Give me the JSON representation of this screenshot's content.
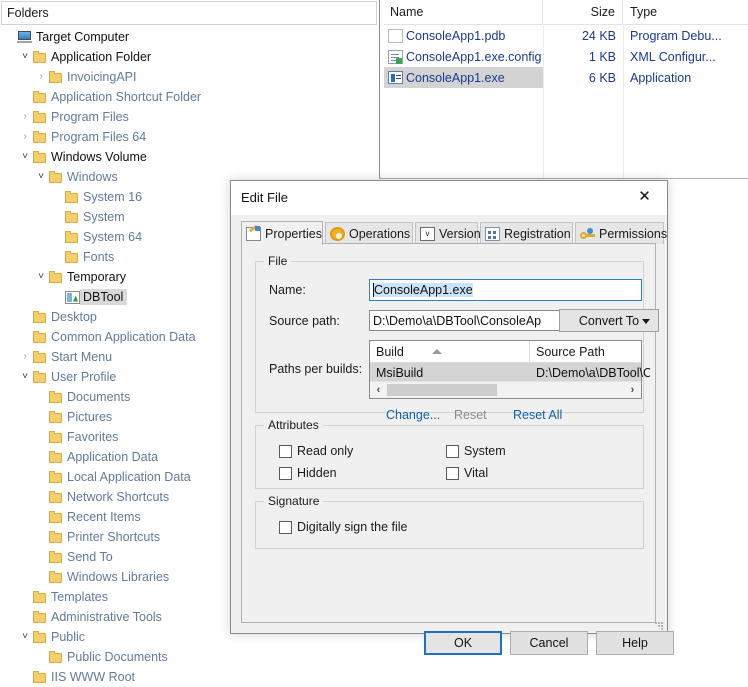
{
  "tree": {
    "header": "Folders",
    "nodes": [
      {
        "label": "Target Computer",
        "indent": 0,
        "chev": "none",
        "icon": "computer-icon",
        "style": "dark"
      },
      {
        "label": "Application Folder",
        "indent": 1,
        "chev": "expanded",
        "icon": "folder-icon",
        "style": "dark"
      },
      {
        "label": "InvoicingAPI",
        "indent": 2,
        "chev": "collapsed",
        "icon": "folder-icon",
        "style": "blue"
      },
      {
        "label": "Application Shortcut Folder",
        "indent": 1,
        "chev": "none",
        "icon": "folder-icon",
        "style": "blue"
      },
      {
        "label": "Program Files",
        "indent": 1,
        "chev": "collapsed",
        "icon": "folder-icon",
        "style": "blue"
      },
      {
        "label": "Program Files 64",
        "indent": 1,
        "chev": "collapsed",
        "icon": "folder-icon",
        "style": "blue"
      },
      {
        "label": "Windows Volume",
        "indent": 1,
        "chev": "expanded",
        "icon": "folder-icon",
        "style": "dark"
      },
      {
        "label": "Windows",
        "indent": 2,
        "chev": "expanded",
        "icon": "folder-icon",
        "style": "blue"
      },
      {
        "label": "System 16",
        "indent": 3,
        "chev": "none",
        "icon": "folder-icon",
        "style": "blue"
      },
      {
        "label": "System",
        "indent": 3,
        "chev": "none",
        "icon": "folder-icon",
        "style": "blue"
      },
      {
        "label": "System 64",
        "indent": 3,
        "chev": "none",
        "icon": "folder-icon",
        "style": "blue"
      },
      {
        "label": "Fonts",
        "indent": 3,
        "chev": "none",
        "icon": "folder-icon",
        "style": "blue"
      },
      {
        "label": "Temporary",
        "indent": 2,
        "chev": "expanded",
        "icon": "folder-icon",
        "style": "dark"
      },
      {
        "label": "DBTool",
        "indent": 3,
        "chev": "none",
        "icon": "application-icon",
        "style": "selected"
      },
      {
        "label": "Desktop",
        "indent": 1,
        "chev": "none",
        "icon": "folder-icon",
        "style": "blue"
      },
      {
        "label": "Common Application Data",
        "indent": 1,
        "chev": "none",
        "icon": "folder-icon",
        "style": "blue"
      },
      {
        "label": "Start Menu",
        "indent": 1,
        "chev": "collapsed",
        "icon": "folder-icon",
        "style": "blue"
      },
      {
        "label": "User Profile",
        "indent": 1,
        "chev": "expanded",
        "icon": "folder-icon",
        "style": "blue"
      },
      {
        "label": "Documents",
        "indent": 2,
        "chev": "none",
        "icon": "folder-icon",
        "style": "blue"
      },
      {
        "label": "Pictures",
        "indent": 2,
        "chev": "none",
        "icon": "folder-icon",
        "style": "blue"
      },
      {
        "label": "Favorites",
        "indent": 2,
        "chev": "none",
        "icon": "folder-icon",
        "style": "blue"
      },
      {
        "label": "Application Data",
        "indent": 2,
        "chev": "none",
        "icon": "folder-icon",
        "style": "blue"
      },
      {
        "label": "Local Application Data",
        "indent": 2,
        "chev": "none",
        "icon": "folder-icon",
        "style": "blue"
      },
      {
        "label": "Network Shortcuts",
        "indent": 2,
        "chev": "none",
        "icon": "folder-icon",
        "style": "blue"
      },
      {
        "label": "Recent Items",
        "indent": 2,
        "chev": "none",
        "icon": "folder-icon",
        "style": "blue"
      },
      {
        "label": "Printer Shortcuts",
        "indent": 2,
        "chev": "none",
        "icon": "folder-icon",
        "style": "blue"
      },
      {
        "label": "Send To",
        "indent": 2,
        "chev": "none",
        "icon": "folder-icon",
        "style": "blue"
      },
      {
        "label": "Windows Libraries",
        "indent": 2,
        "chev": "none",
        "icon": "folder-icon",
        "style": "blue"
      },
      {
        "label": "Templates",
        "indent": 1,
        "chev": "none",
        "icon": "folder-icon",
        "style": "blue"
      },
      {
        "label": "Administrative Tools",
        "indent": 1,
        "chev": "none",
        "icon": "folder-icon",
        "style": "blue"
      },
      {
        "label": "Public",
        "indent": 1,
        "chev": "expanded",
        "icon": "folder-icon",
        "style": "blue"
      },
      {
        "label": "Public Documents",
        "indent": 2,
        "chev": "none",
        "icon": "folder-icon",
        "style": "blue"
      },
      {
        "label": "IIS WWW Root",
        "indent": 1,
        "chev": "none",
        "icon": "folder-icon",
        "style": "blue"
      }
    ]
  },
  "filelist": {
    "columns": [
      "Name",
      "Size",
      "Type"
    ],
    "rows": [
      {
        "name": "ConsoleApp1.pdb",
        "size": "24 KB",
        "type": "Program Debu...",
        "icon": "document-icon",
        "selected": false
      },
      {
        "name": "ConsoleApp1.exe.config",
        "size": "1 KB",
        "type": "XML Configur...",
        "icon": "xml-file-icon",
        "selected": false
      },
      {
        "name": "ConsoleApp1.exe",
        "size": "6 KB",
        "type": "Application",
        "icon": "executable-icon",
        "selected": true
      }
    ]
  },
  "dialog": {
    "title": "Edit File",
    "close_label": "✕",
    "tabs": [
      {
        "label": "Properties",
        "icon": "properties-icon",
        "active": true
      },
      {
        "label": "Operations",
        "icon": "gear-icon",
        "active": false
      },
      {
        "label": "Version",
        "icon": "version-icon",
        "active": false
      },
      {
        "label": "Registration",
        "icon": "registration-icon",
        "active": false
      },
      {
        "label": "Permissions",
        "icon": "key-icon",
        "active": false
      }
    ],
    "file_group": {
      "legend": "File",
      "name_label": "Name:",
      "name_value": "ConsoleApp1.exe",
      "source_path_label": "Source path:",
      "source_path_value": "D:\\Demo\\a\\DBTool\\ConsoleAp",
      "browse_label": "...",
      "convert_label": "Convert To",
      "paths_label": "Paths per builds:",
      "grid_columns": [
        "Build",
        "Source Path"
      ],
      "grid_rows": [
        {
          "build": "MsiBuild",
          "source_path": "D:\\Demo\\a\\DBTool\\Co",
          "selected": true
        }
      ],
      "scroll_left": "‹",
      "scroll_right": "›",
      "links": [
        {
          "label": "Change...",
          "enabled": true
        },
        {
          "label": "Reset",
          "enabled": false
        },
        {
          "label": "Reset All",
          "enabled": true
        }
      ]
    },
    "attributes_group": {
      "legend": "Attributes",
      "items": [
        {
          "label": "Read only",
          "checked": false
        },
        {
          "label": "Hidden",
          "checked": false
        },
        {
          "label": "System",
          "checked": false
        },
        {
          "label": "Vital",
          "checked": false
        }
      ]
    },
    "signature_group": {
      "legend": "Signature",
      "items": [
        {
          "label": "Digitally sign the file",
          "checked": false
        }
      ]
    },
    "buttons": {
      "ok": "OK",
      "cancel": "Cancel",
      "help": "Help"
    }
  },
  "colors": {
    "link": "#1060a8",
    "tree_blue": "#5f7b9c",
    "file_blue": "#1a3a8f",
    "accent": "#1f6fc4",
    "selection": "#cce4f7"
  }
}
